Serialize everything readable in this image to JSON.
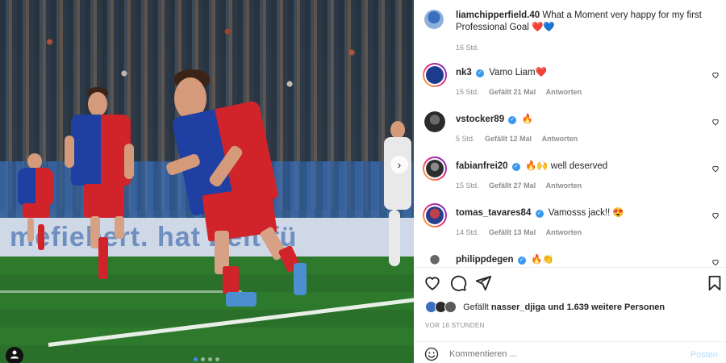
{
  "photo": {
    "board_text": "mefiebert. hat Zeit fü",
    "next_icon": "›",
    "slides_count": 4,
    "active_slide": 1
  },
  "post": {
    "author": "liamchipperfield.40",
    "caption": "What a Moment very happy for my first Professional Goal",
    "caption_emoji": "❤️💙",
    "time": "16 Std."
  },
  "comments": [
    {
      "user": "nk3",
      "verified": true,
      "text": "Vamo Liam❤️",
      "time": "15 Std.",
      "likes": "Gefällt 21 Mal",
      "reply": "Antworten",
      "avatar_color": "#1d3b8c",
      "ring": true
    },
    {
      "user": "vstocker89",
      "verified": true,
      "text": "🔥",
      "time": "5 Std.",
      "likes": "Gefällt 12 Mal",
      "reply": "Antworten",
      "avatar_color": "#2b2b2b",
      "ring": false
    },
    {
      "user": "fabianfrei20",
      "verified": true,
      "text": "🔥🙌 well deserved",
      "time": "15 Std.",
      "likes": "Gefällt 27 Mal",
      "reply": "Antworten",
      "avatar_color": "#3a3a3a",
      "ring": true
    },
    {
      "user": "tomas_tavares84",
      "verified": true,
      "text": "Vamosss jack!! 😍",
      "time": "14 Std.",
      "likes": "Gefällt 13 Mal",
      "reply": "Antworten",
      "avatar_color": "#7a2a3a",
      "ring": true
    },
    {
      "user": "philippdegen",
      "verified": true,
      "text": "🔥👏",
      "time": "",
      "likes": "",
      "reply": "",
      "avatar_color": "#555555",
      "ring": false
    }
  ],
  "actions": {
    "like_icon": "heart-icon",
    "comment_icon": "comment-icon",
    "share_icon": "share-icon",
    "save_icon": "bookmark-icon"
  },
  "likes_summary": {
    "prefix": "Gefällt",
    "user": "nasser_djiga",
    "suffix": "und 1.639 weitere Personen"
  },
  "timestamp": "VOR 16 STUNDEN",
  "comment_box": {
    "placeholder": "Kommentieren ...",
    "post_label": "Posten"
  },
  "colors": {
    "link": "#3897f0",
    "post_disabled": "#b2dffc",
    "muted": "#8e8e8e"
  }
}
